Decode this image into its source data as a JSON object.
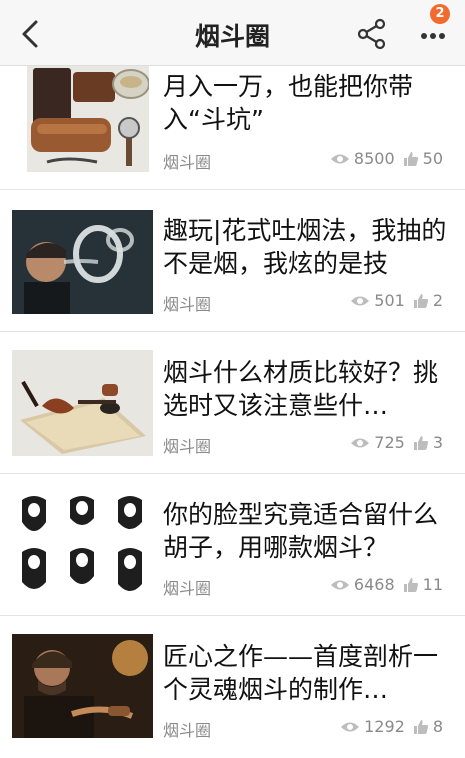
{
  "header": {
    "title": "烟斗圈",
    "badge_count": "2",
    "back_icon": "chevron-left-icon",
    "share_icon": "share-icon",
    "more_icon": "more-dots-icon"
  },
  "articles": [
    {
      "title": "月入一万，也能把你带入“斗坑”",
      "source": "烟斗圈",
      "views": "8500",
      "likes": "50",
      "thumb": "pipe-accessories"
    },
    {
      "title": "趣玩|花式吐烟法，我抽的不是烟，我炫的是技",
      "source": "烟斗圈",
      "views": "501",
      "likes": "2",
      "thumb": "smoke-rings"
    },
    {
      "title": "烟斗什么材质比较好？挑选时又该注意些什…",
      "source": "烟斗圈",
      "views": "725",
      "likes": "3",
      "thumb": "pipes-on-paper"
    },
    {
      "title": "你的脸型究竟适合留什么胡子，用哪款烟斗？",
      "source": "烟斗圈",
      "views": "6468",
      "likes": "11",
      "thumb": "beard-styles"
    },
    {
      "title": "匠心之作——首度剖析一个灵魂烟斗的制作…",
      "source": "烟斗圈",
      "views": "1292",
      "likes": "8",
      "thumb": "pipe-craftsman"
    }
  ]
}
